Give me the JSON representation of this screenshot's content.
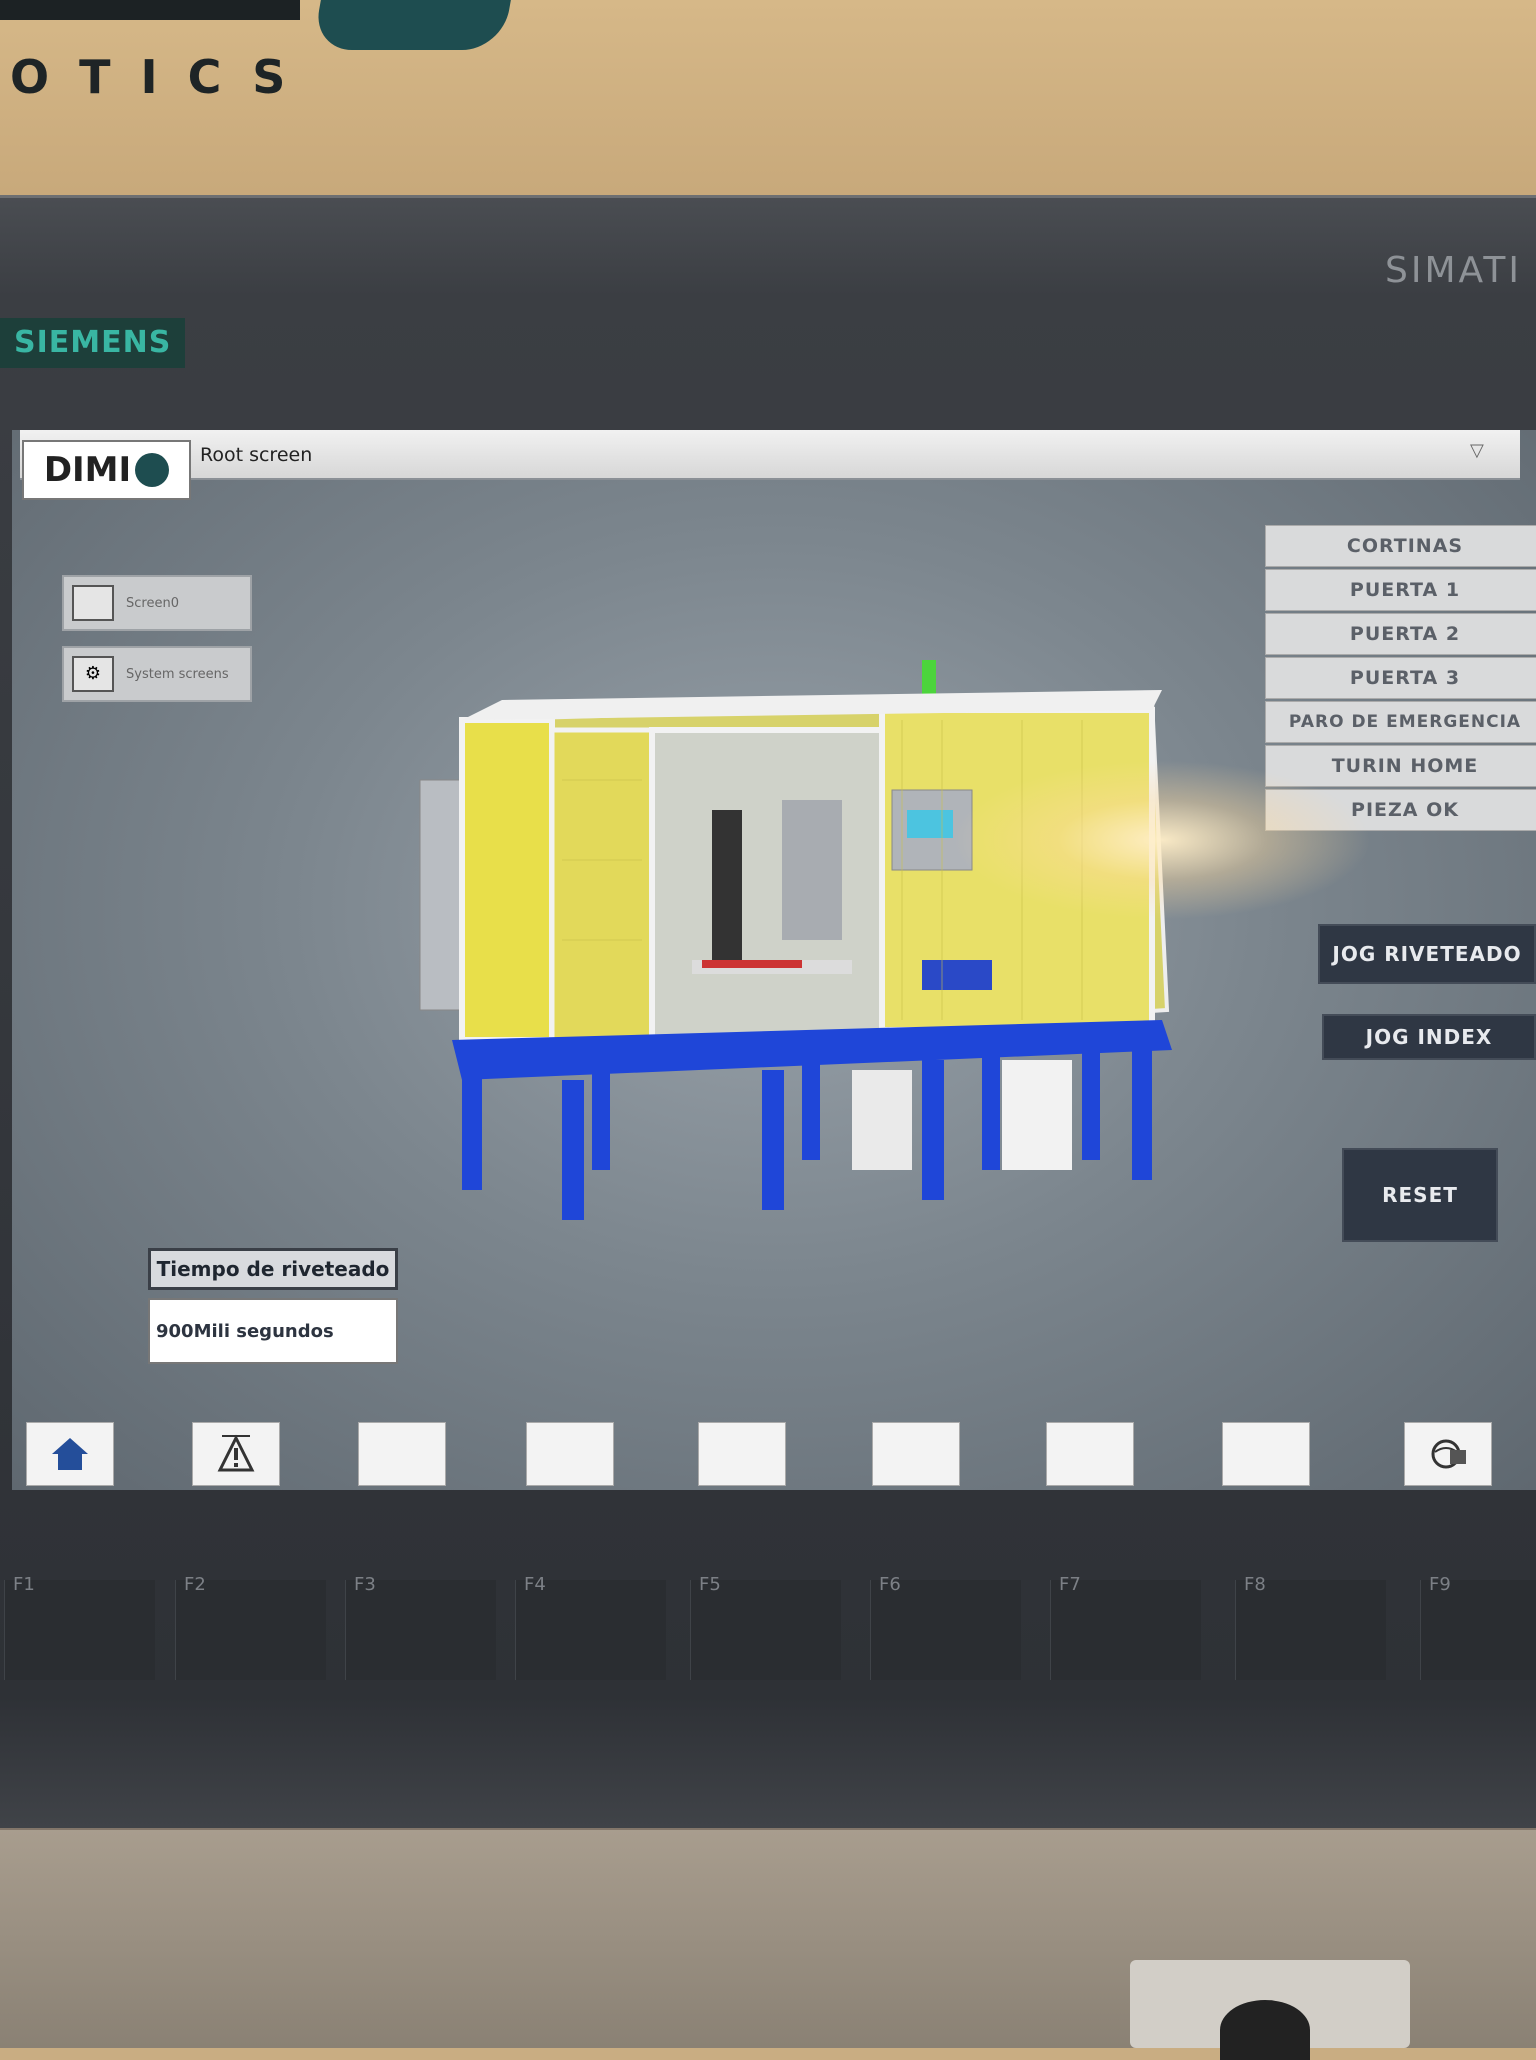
{
  "wall": {
    "brand_text": "OTICS"
  },
  "device": {
    "brand": "SIEMENS",
    "model_label": "SIMATI"
  },
  "screen": {
    "logo": "DIMI",
    "title": "Root screen",
    "nav_buttons": [
      {
        "label": "Screen0",
        "icon": "screen-icon"
      },
      {
        "label": "System screens",
        "icon": "system-screens-icon"
      }
    ],
    "status_list": [
      "CORTINAS",
      "PUERTA 1",
      "PUERTA 2",
      "PUERTA 3",
      "PARO DE EMERGENCIA",
      "TURIN HOME",
      "PIEZA OK"
    ],
    "buttons": {
      "jog_riveteado": "JOG RIVETEADO",
      "jog_index": "JOG INDEX",
      "reset": "RESET"
    },
    "tiempo": {
      "label": "Tiempo de riveteado",
      "value": "900Mili segundos"
    },
    "bottom_bar": [
      {
        "icon": "home-icon"
      },
      {
        "icon": "alarm-icon"
      },
      {
        "icon": ""
      },
      {
        "icon": ""
      },
      {
        "icon": ""
      },
      {
        "icon": ""
      },
      {
        "icon": ""
      },
      {
        "icon": ""
      },
      {
        "icon": "language-icon"
      }
    ],
    "colors": {
      "machine_frame": "#1f46d8",
      "machine_panels": "#e8df4a",
      "dark_button": "#2f3744"
    }
  },
  "function_keys": [
    "F1",
    "F2",
    "F3",
    "F4",
    "F5",
    "F6",
    "F7",
    "F8",
    "F9"
  ]
}
